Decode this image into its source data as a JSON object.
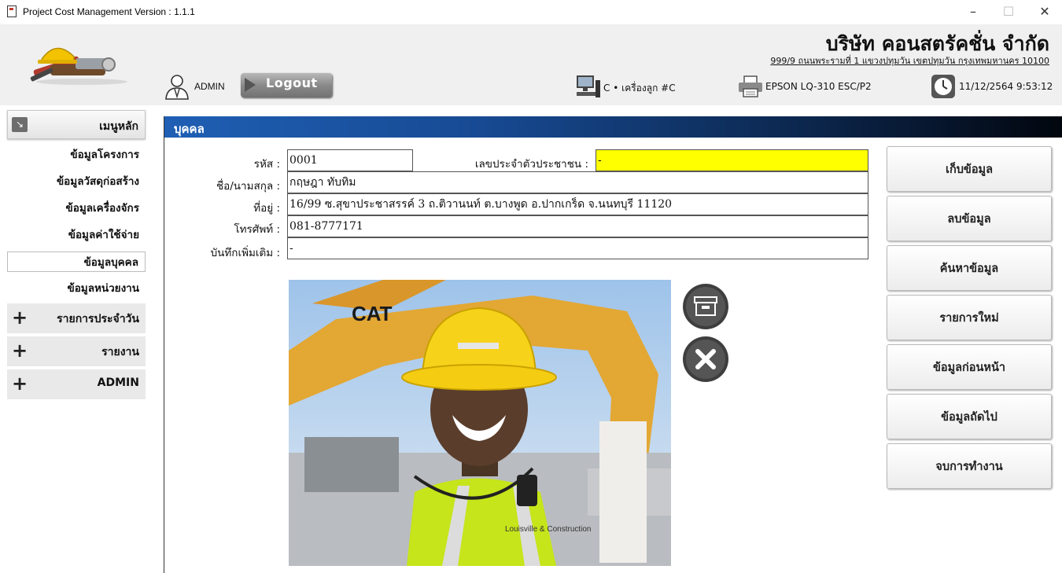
{
  "window": {
    "title": "Project Cost Management Version : 1.1.1",
    "minimize": "–",
    "maximize": "☐",
    "close": "✕"
  },
  "header": {
    "company_name": "บริษัท คอนสตรัคชั่น จำกัด",
    "company_address": "999/9 ถนนพระรามที่ 1 แขวงปทุมวัน เขตปทุมวัน กรุงเทพมหานคร 10100",
    "user": "ADMIN",
    "logout_label": "Logout",
    "computer": "C • เครื่องลูก #C",
    "printer": "EPSON LQ-310 ESC/P2",
    "datetime": "11/12/2564 9:53:12"
  },
  "sidebar": {
    "main_menu_label": "เมนูหลัก",
    "items": [
      {
        "label": "ข้อมูลโครงการ",
        "active": false
      },
      {
        "label": "ข้อมูลวัสดุก่อสร้าง",
        "active": false
      },
      {
        "label": "ข้อมูลเครื่องจักร",
        "active": false
      },
      {
        "label": "ข้อมูลค่าใช้จ่าย",
        "active": false
      },
      {
        "label": "ข้อมูลบุคคล",
        "active": true
      },
      {
        "label": "ข้อมูลหน่วยงาน",
        "active": false
      }
    ],
    "groups": [
      {
        "label": "รายการประจำวัน"
      },
      {
        "label": "รายงาน"
      },
      {
        "label": "ADMIN"
      }
    ]
  },
  "panel": {
    "title": "บุคคล",
    "form": {
      "id_label": "รหัส :",
      "id_value": "0001",
      "id_card_label": "เลขประจำตัวประชาชน :",
      "id_card_value": "-",
      "name_label": "ชื่อ/นามสกุล :",
      "name_value": "กฤษฎา ทับทิม",
      "address_label": "ที่อยู่ :",
      "address_value": "16/99 ซ.สุขาประชาสรรค์ 3 ถ.ติวานนท์ ต.บางพูด อ.ปากเกร็ด จ.นนทบุรี 11120",
      "phone_label": "โทรศัพท์ :",
      "phone_value": "081-8777171",
      "note_label": "บันทึกเพิ่มเติม :",
      "note_value": "-"
    },
    "photo_buttons": {
      "browse_icon": "archive-icon",
      "remove_icon": "close-icon"
    },
    "photo_text": {
      "brand": "CAT",
      "vest": "Louisville & Construction"
    },
    "actions": [
      {
        "label": "เก็บข้อมูล"
      },
      {
        "label": "ลบข้อมูล"
      },
      {
        "label": "ค้นหาข้อมูล"
      },
      {
        "label": "รายการใหม่"
      },
      {
        "label": "ข้อมูลก่อนหน้า"
      },
      {
        "label": "ข้อมูลถัดไป"
      },
      {
        "label": "จบการทำงาน"
      }
    ]
  },
  "colors": {
    "panel_header_start": "#1f5fb4",
    "panel_header_end": "#02060e",
    "id_card_field": "#ffff00"
  }
}
